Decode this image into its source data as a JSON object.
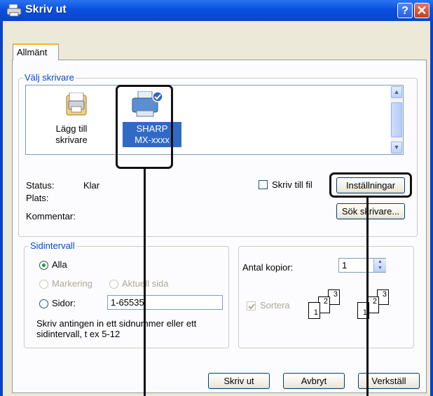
{
  "window": {
    "title": "Skriv ut",
    "help_label": "?",
    "close_label": "✕",
    "icon": "printer-icon"
  },
  "tabs": [
    {
      "label": "Allmänt",
      "active": true
    }
  ],
  "select_printer": {
    "group_title": "Välj skrivare",
    "items": [
      {
        "label_line1": "Lägg till",
        "label_line2": "skrivare",
        "icon": "add-printer-icon",
        "selected": false
      },
      {
        "label_line1": "SHARP",
        "label_line2": "MX-xxxx",
        "icon": "printer-icon",
        "selected": true,
        "default": true
      }
    ],
    "status_label": "Status:",
    "status_value": "Klar",
    "location_label": "Plats:",
    "comment_label": "Kommentar:",
    "print_to_file_label": "Skriv till fil",
    "print_to_file_checked": false,
    "preferences_button": "Inställningar",
    "find_printer_button": "Sök skrivare..."
  },
  "page_range": {
    "group_title": "Sidintervall",
    "all_label": "Alla",
    "selection_label": "Markering",
    "current_page_label": "Aktuell sida",
    "pages_label": "Sidor:",
    "pages_value": "1-65535",
    "selected": "all",
    "hint_line1": "Skriv antingen in ett sidnummer eller ett",
    "hint_line2": "sidintervall, t ex 5-12"
  },
  "copies": {
    "copies_label": "Antal kopior:",
    "copies_value": "1",
    "collate_label": "Sortera",
    "collate_checked": true,
    "collate_icon_pages": [
      "1",
      "2",
      "3",
      "1",
      "2",
      "3"
    ]
  },
  "footer": {
    "print_button": "Skriv ut",
    "cancel_button": "Avbryt",
    "apply_button": "Verkställ"
  },
  "colors": {
    "titlebar": "#0a50e0",
    "accent": "#0046d5",
    "dialog_bg": "#ece9d8",
    "callout": "#111111"
  }
}
